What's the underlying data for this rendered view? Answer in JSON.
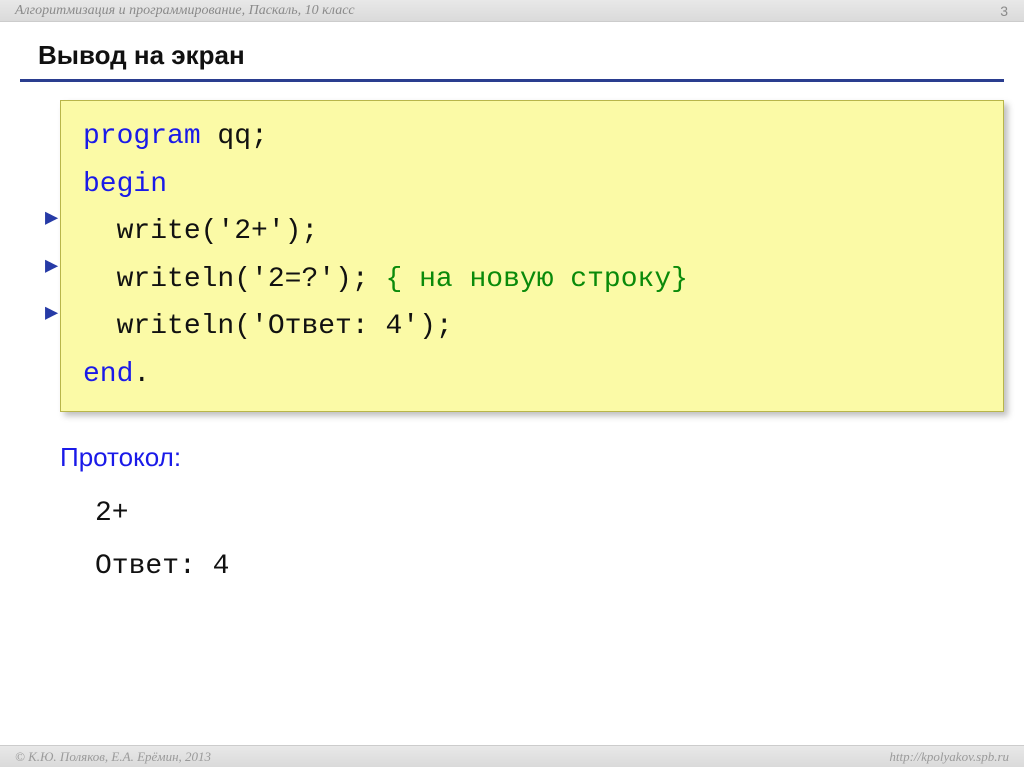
{
  "header": {
    "breadcrumb": "Алгоритмизация и программирование, Паскаль, 10 класс",
    "page_number": "3"
  },
  "title": "Вывод на экран",
  "code": {
    "l1_kw": "program",
    "l1_rest": " qq;",
    "l2_kw": "begin",
    "l3": "  write('2+');",
    "l4_a": "  write",
    "l4_b": "ln",
    "l4_c": "('2=?'); ",
    "l4_comment": "{ на новую строку}",
    "l5_a": "  write",
    "l5_b": "ln",
    "l5_c": "('Ответ: 4');",
    "l6_kw": "end",
    "l6_rest": "."
  },
  "protocol": {
    "label": "Протокол:",
    "line1": "2+",
    "line2": "Ответ: 4"
  },
  "footer": {
    "copyright": "© К.Ю. Поляков, Е.А. Ерёмин, 2013",
    "url": "http://kpolyakov.spb.ru"
  }
}
